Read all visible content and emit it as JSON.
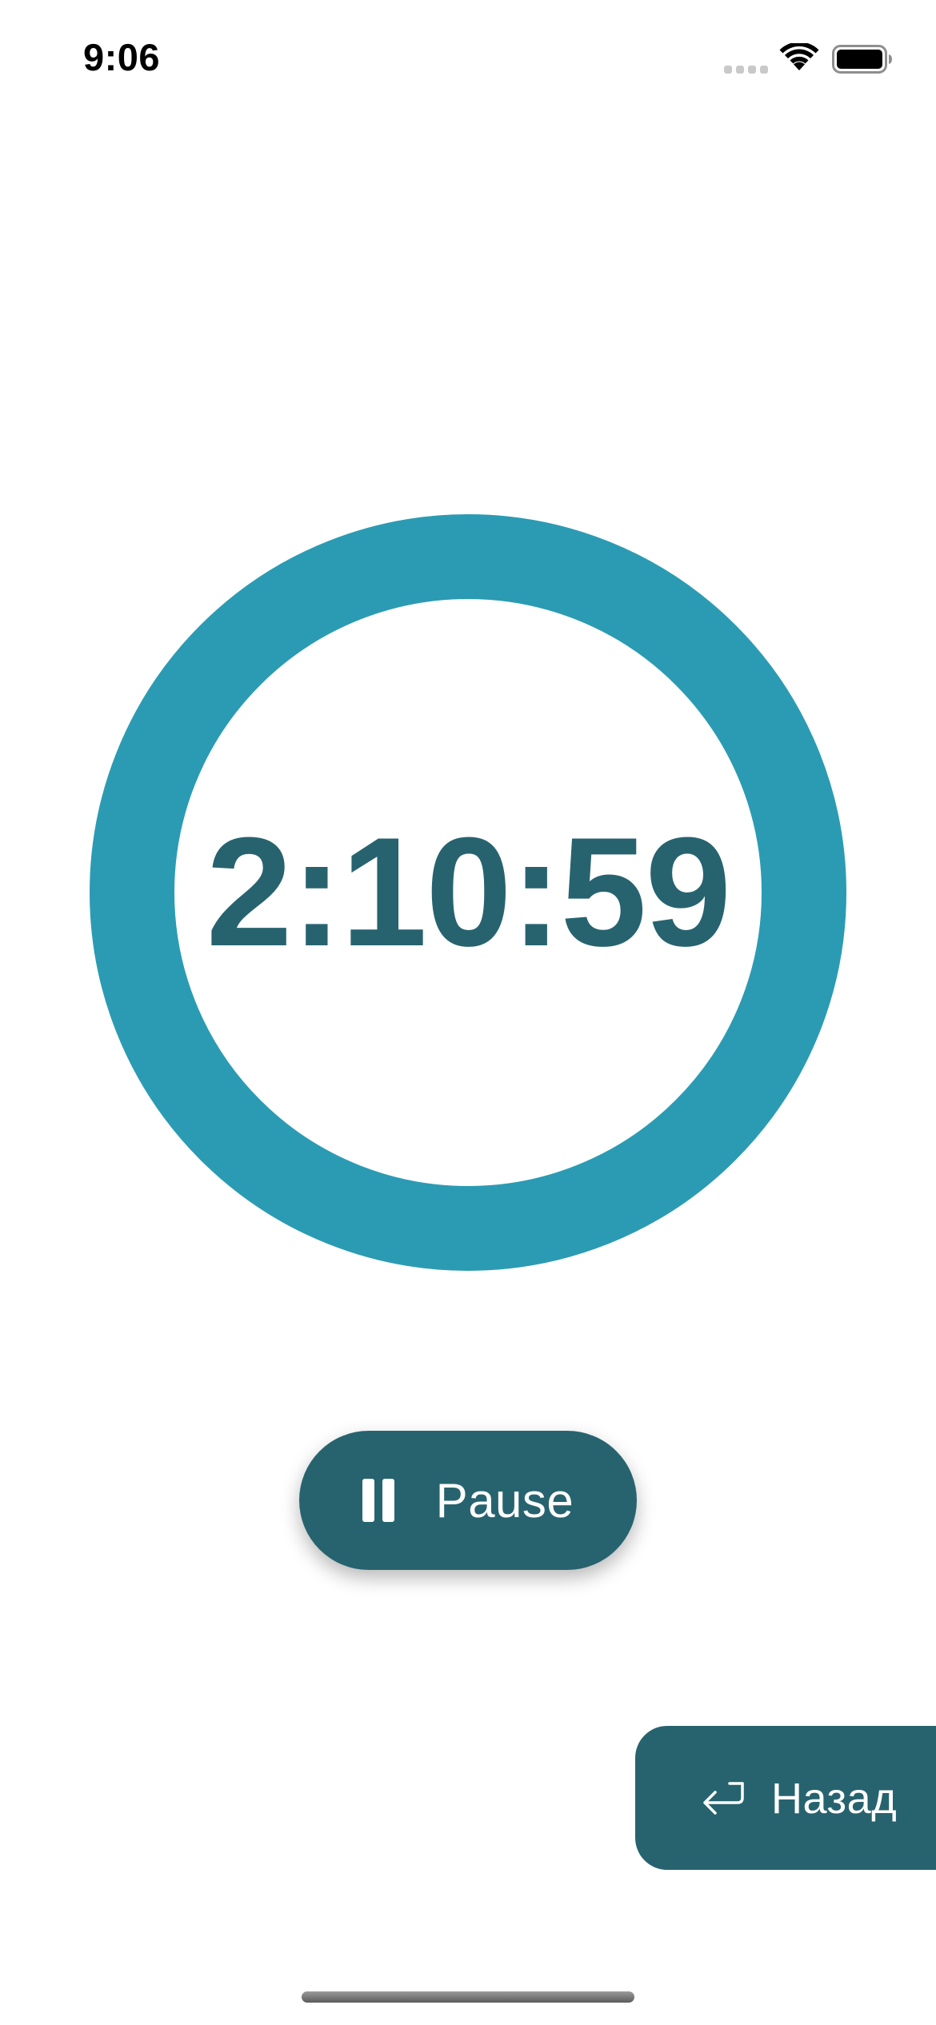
{
  "status_bar": {
    "time": "9:06",
    "signal_icon": "cellular-signal-icon",
    "wifi_icon": "wifi-icon",
    "battery_icon": "battery-icon"
  },
  "timer": {
    "display": "2:10:59",
    "ring_color": "#2b9bb3",
    "text_color": "#27636f"
  },
  "pause_button": {
    "label": "Pause",
    "icon": "pause-icon",
    "color": "#27636f"
  },
  "back_button": {
    "label": "Назад",
    "icon": "return-arrow-icon",
    "color": "#27636f"
  },
  "colors": {
    "background": "#ffffff",
    "accent_ring": "#2b9bb3",
    "primary_dark": "#27636f"
  }
}
